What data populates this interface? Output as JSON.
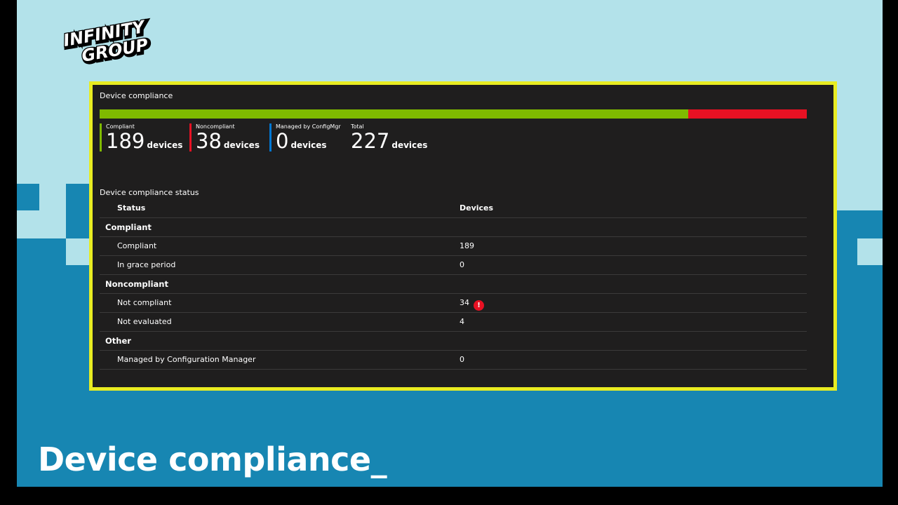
{
  "slide": {
    "logo_text": [
      "INFINITY",
      "GROUP"
    ],
    "title": "Device compliance_"
  },
  "panel": {
    "title": "Device compliance",
    "bar": [
      {
        "key": "compliant",
        "fraction": 0.8326,
        "color": "#7fba00"
      },
      {
        "key": "noncompliant",
        "fraction": 0.1674,
        "color": "#e81123"
      }
    ],
    "stats": [
      {
        "label": "Compliant",
        "value": "189",
        "unit": "devices",
        "color": "#7fba00"
      },
      {
        "label": "Noncompliant",
        "value": "38",
        "unit": "devices",
        "color": "#e81123"
      },
      {
        "label": "Managed by ConfigMgr",
        "value": "0",
        "unit": "devices",
        "color": "#0078d4"
      },
      {
        "label": "Total",
        "value": "227",
        "unit": "devices",
        "color": "transparent"
      }
    ],
    "status_title": "Device compliance status",
    "table": {
      "headers": [
        "Status",
        "Devices"
      ],
      "rows": [
        {
          "type": "group",
          "status": "Compliant",
          "devices": ""
        },
        {
          "type": "item",
          "status": "Compliant",
          "devices": "189"
        },
        {
          "type": "item",
          "status": "In grace period",
          "devices": "0"
        },
        {
          "type": "group",
          "status": "Noncompliant",
          "devices": ""
        },
        {
          "type": "item",
          "status": "Not compliant",
          "devices": "34",
          "alert": "!"
        },
        {
          "type": "item",
          "status": "Not evaluated",
          "devices": "4"
        },
        {
          "type": "group",
          "status": "Other",
          "devices": ""
        },
        {
          "type": "item",
          "status": "Managed by Configuration Manager",
          "devices": "0"
        }
      ]
    }
  },
  "colors": {
    "background_light": "#b3e2ea",
    "background_blue": "#1786b2",
    "highlight_border": "#e8ec22",
    "panel_bg": "#1f1e1e"
  }
}
